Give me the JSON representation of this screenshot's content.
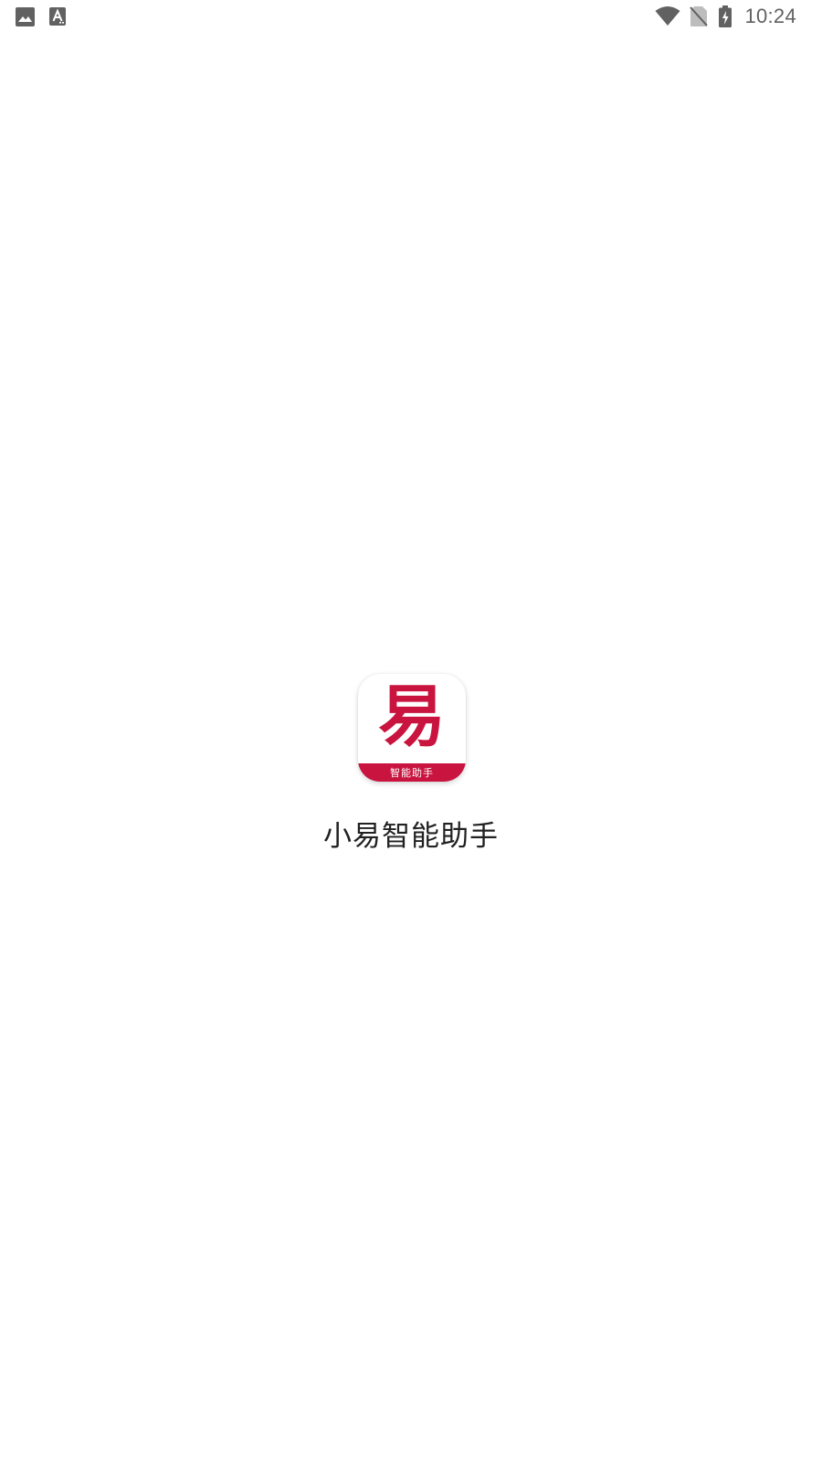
{
  "status_bar": {
    "left_icons": [
      "image-icon",
      "font-icon"
    ],
    "right_icons": [
      "wifi-icon",
      "no-sim-icon",
      "battery-charging-icon"
    ],
    "time": "10:24",
    "icon_color": "#616161"
  },
  "splash": {
    "logo_glyph": "易",
    "logo_caption": "智能助手",
    "app_name": "小易智能助手",
    "brand_color": "#c8143f"
  }
}
